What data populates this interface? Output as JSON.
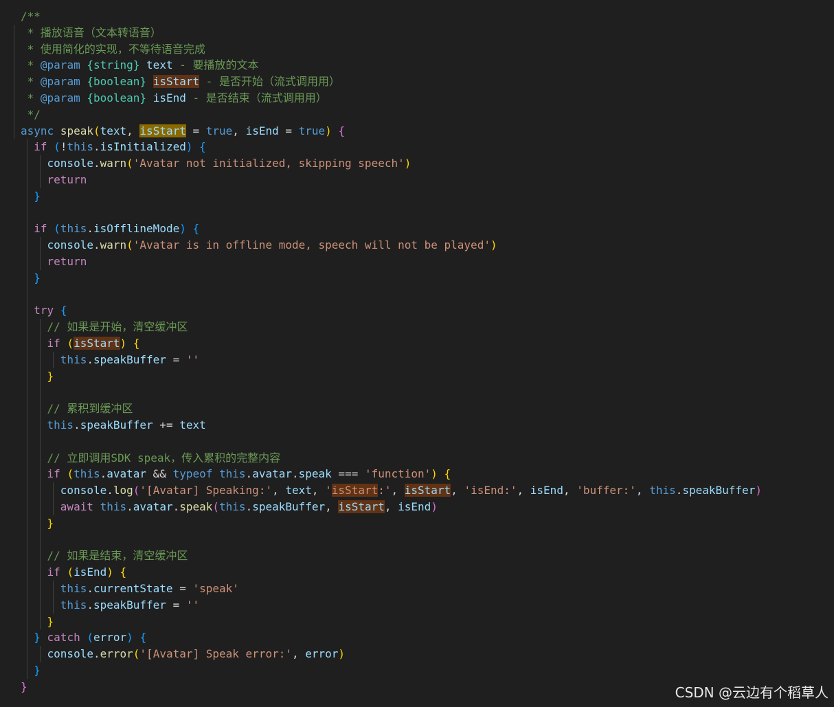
{
  "colors": {
    "background": "#1f1f1f",
    "comment": "#6a9955",
    "keyword_control": "#c586c0",
    "keyword": "#569cd6",
    "function": "#dcdcaa",
    "variable": "#9cdcfe",
    "string": "#ce9178",
    "plain": "#d4d4d4",
    "bracket_gold": "#ffd700",
    "bracket_purple": "#da70d6",
    "bracket_blue": "#179fff",
    "jsdoc_type": "#4ec9b0"
  },
  "code_lines": [
    [
      {
        "t": "/**",
        "c": "comment"
      }
    ],
    [
      {
        "t": " * 播放语音（文本转语音）",
        "c": "comment"
      }
    ],
    [
      {
        "t": " * 使用简化的实现，不等待语音完成",
        "c": "comment"
      }
    ],
    [
      {
        "t": " * ",
        "c": "comment"
      },
      {
        "t": "@param",
        "c": "keyword"
      },
      {
        "t": " ",
        "c": "comment"
      },
      {
        "t": "{string}",
        "c": "jsdoc_type"
      },
      {
        "t": " ",
        "c": "comment"
      },
      {
        "t": "text",
        "c": "variable"
      },
      {
        "t": " - 要播放的文本",
        "c": "comment"
      }
    ],
    [
      {
        "t": " * ",
        "c": "comment"
      },
      {
        "t": "@param",
        "c": "keyword"
      },
      {
        "t": " ",
        "c": "comment"
      },
      {
        "t": "{boolean}",
        "c": "jsdoc_type"
      },
      {
        "t": " ",
        "c": "comment"
      },
      {
        "t": "isStart",
        "c": "variable",
        "hl": "hl"
      },
      {
        "t": " - 是否开始（流式调用用）",
        "c": "comment"
      }
    ],
    [
      {
        "t": " * ",
        "c": "comment"
      },
      {
        "t": "@param",
        "c": "keyword"
      },
      {
        "t": " ",
        "c": "comment"
      },
      {
        "t": "{boolean}",
        "c": "jsdoc_type"
      },
      {
        "t": " ",
        "c": "comment"
      },
      {
        "t": "isEnd",
        "c": "variable"
      },
      {
        "t": " - 是否结束（流式调用用）",
        "c": "comment"
      }
    ],
    [
      {
        "t": " */",
        "c": "comment"
      }
    ],
    [
      {
        "t": "async",
        "c": "keyword"
      },
      {
        "t": " ",
        "c": "plain"
      },
      {
        "t": "speak",
        "c": "function"
      },
      {
        "t": "(",
        "c": "bracket_gold"
      },
      {
        "t": "text",
        "c": "variable"
      },
      {
        "t": ", ",
        "c": "plain"
      },
      {
        "t": "isStart",
        "c": "variable",
        "hl": "hl-strong"
      },
      {
        "t": " = ",
        "c": "plain"
      },
      {
        "t": "true",
        "c": "keyword"
      },
      {
        "t": ", ",
        "c": "plain"
      },
      {
        "t": "isEnd",
        "c": "variable"
      },
      {
        "t": " = ",
        "c": "plain"
      },
      {
        "t": "true",
        "c": "keyword"
      },
      {
        "t": ")",
        "c": "bracket_gold"
      },
      {
        "t": " ",
        "c": "plain"
      },
      {
        "t": "{",
        "c": "bracket_purple"
      }
    ],
    [
      {
        "t": "  ",
        "c": "plain"
      },
      {
        "t": "if",
        "c": "keyword_control"
      },
      {
        "t": " ",
        "c": "plain"
      },
      {
        "t": "(",
        "c": "bracket_blue"
      },
      {
        "t": "!",
        "c": "plain"
      },
      {
        "t": "this",
        "c": "keyword"
      },
      {
        "t": ".",
        "c": "plain"
      },
      {
        "t": "isInitialized",
        "c": "variable"
      },
      {
        "t": ")",
        "c": "bracket_blue"
      },
      {
        "t": " ",
        "c": "plain"
      },
      {
        "t": "{",
        "c": "bracket_blue"
      }
    ],
    [
      {
        "t": "    ",
        "c": "plain"
      },
      {
        "t": "console",
        "c": "variable"
      },
      {
        "t": ".",
        "c": "plain"
      },
      {
        "t": "warn",
        "c": "function"
      },
      {
        "t": "(",
        "c": "bracket_gold"
      },
      {
        "t": "'Avatar not initialized, skipping speech'",
        "c": "string"
      },
      {
        "t": ")",
        "c": "bracket_gold"
      }
    ],
    [
      {
        "t": "    ",
        "c": "plain"
      },
      {
        "t": "return",
        "c": "keyword_control"
      }
    ],
    [
      {
        "t": "  ",
        "c": "plain"
      },
      {
        "t": "}",
        "c": "bracket_blue"
      }
    ],
    [],
    [
      {
        "t": "  ",
        "c": "plain"
      },
      {
        "t": "if",
        "c": "keyword_control"
      },
      {
        "t": " ",
        "c": "plain"
      },
      {
        "t": "(",
        "c": "bracket_blue"
      },
      {
        "t": "this",
        "c": "keyword"
      },
      {
        "t": ".",
        "c": "plain"
      },
      {
        "t": "isOfflineMode",
        "c": "variable"
      },
      {
        "t": ")",
        "c": "bracket_blue"
      },
      {
        "t": " ",
        "c": "plain"
      },
      {
        "t": "{",
        "c": "bracket_blue"
      }
    ],
    [
      {
        "t": "    ",
        "c": "plain"
      },
      {
        "t": "console",
        "c": "variable"
      },
      {
        "t": ".",
        "c": "plain"
      },
      {
        "t": "warn",
        "c": "function"
      },
      {
        "t": "(",
        "c": "bracket_gold"
      },
      {
        "t": "'Avatar is in offline mode, speech will not be played'",
        "c": "string"
      },
      {
        "t": ")",
        "c": "bracket_gold"
      }
    ],
    [
      {
        "t": "    ",
        "c": "plain"
      },
      {
        "t": "return",
        "c": "keyword_control"
      }
    ],
    [
      {
        "t": "  ",
        "c": "plain"
      },
      {
        "t": "}",
        "c": "bracket_blue"
      }
    ],
    [],
    [
      {
        "t": "  ",
        "c": "plain"
      },
      {
        "t": "try",
        "c": "keyword_control"
      },
      {
        "t": " ",
        "c": "plain"
      },
      {
        "t": "{",
        "c": "bracket_blue"
      }
    ],
    [
      {
        "t": "    ",
        "c": "plain"
      },
      {
        "t": "// 如果是开始，清空缓冲区",
        "c": "comment"
      }
    ],
    [
      {
        "t": "    ",
        "c": "plain"
      },
      {
        "t": "if",
        "c": "keyword_control"
      },
      {
        "t": " ",
        "c": "plain"
      },
      {
        "t": "(",
        "c": "bracket_gold"
      },
      {
        "t": "isStart",
        "c": "variable",
        "hl": "hl"
      },
      {
        "t": ")",
        "c": "bracket_gold"
      },
      {
        "t": " ",
        "c": "plain"
      },
      {
        "t": "{",
        "c": "bracket_gold"
      }
    ],
    [
      {
        "t": "      ",
        "c": "plain"
      },
      {
        "t": "this",
        "c": "keyword"
      },
      {
        "t": ".",
        "c": "plain"
      },
      {
        "t": "speakBuffer",
        "c": "variable"
      },
      {
        "t": " = ",
        "c": "plain"
      },
      {
        "t": "''",
        "c": "string"
      }
    ],
    [
      {
        "t": "    ",
        "c": "plain"
      },
      {
        "t": "}",
        "c": "bracket_gold"
      }
    ],
    [],
    [
      {
        "t": "    ",
        "c": "plain"
      },
      {
        "t": "// 累积到缓冲区",
        "c": "comment"
      }
    ],
    [
      {
        "t": "    ",
        "c": "plain"
      },
      {
        "t": "this",
        "c": "keyword"
      },
      {
        "t": ".",
        "c": "plain"
      },
      {
        "t": "speakBuffer",
        "c": "variable"
      },
      {
        "t": " += ",
        "c": "plain"
      },
      {
        "t": "text",
        "c": "variable"
      }
    ],
    [],
    [
      {
        "t": "    ",
        "c": "plain"
      },
      {
        "t": "// 立即调用SDK speak，传入累积的完整内容",
        "c": "comment"
      }
    ],
    [
      {
        "t": "    ",
        "c": "plain"
      },
      {
        "t": "if",
        "c": "keyword_control"
      },
      {
        "t": " ",
        "c": "plain"
      },
      {
        "t": "(",
        "c": "bracket_gold"
      },
      {
        "t": "this",
        "c": "keyword"
      },
      {
        "t": ".",
        "c": "plain"
      },
      {
        "t": "avatar",
        "c": "variable"
      },
      {
        "t": " && ",
        "c": "plain"
      },
      {
        "t": "typeof",
        "c": "keyword"
      },
      {
        "t": " ",
        "c": "plain"
      },
      {
        "t": "this",
        "c": "keyword"
      },
      {
        "t": ".",
        "c": "plain"
      },
      {
        "t": "avatar",
        "c": "variable"
      },
      {
        "t": ".",
        "c": "plain"
      },
      {
        "t": "speak",
        "c": "variable"
      },
      {
        "t": " === ",
        "c": "plain"
      },
      {
        "t": "'function'",
        "c": "string"
      },
      {
        "t": ")",
        "c": "bracket_gold"
      },
      {
        "t": " ",
        "c": "plain"
      },
      {
        "t": "{",
        "c": "bracket_gold"
      }
    ],
    [
      {
        "t": "      ",
        "c": "plain"
      },
      {
        "t": "console",
        "c": "variable"
      },
      {
        "t": ".",
        "c": "plain"
      },
      {
        "t": "log",
        "c": "function"
      },
      {
        "t": "(",
        "c": "bracket_purple"
      },
      {
        "t": "'[Avatar] Speaking:'",
        "c": "string"
      },
      {
        "t": ", ",
        "c": "plain"
      },
      {
        "t": "text",
        "c": "variable"
      },
      {
        "t": ", ",
        "c": "plain"
      },
      {
        "t": "'",
        "c": "string"
      },
      {
        "t": "isStart",
        "c": "string",
        "hl": "hl"
      },
      {
        "t": ":'",
        "c": "string"
      },
      {
        "t": ", ",
        "c": "plain"
      },
      {
        "t": "isStart",
        "c": "variable",
        "hl": "hl"
      },
      {
        "t": ", ",
        "c": "plain"
      },
      {
        "t": "'isEnd:'",
        "c": "string"
      },
      {
        "t": ", ",
        "c": "plain"
      },
      {
        "t": "isEnd",
        "c": "variable"
      },
      {
        "t": ", ",
        "c": "plain"
      },
      {
        "t": "'buffer:'",
        "c": "string"
      },
      {
        "t": ", ",
        "c": "plain"
      },
      {
        "t": "this",
        "c": "keyword"
      },
      {
        "t": ".",
        "c": "plain"
      },
      {
        "t": "speakBuffer",
        "c": "variable"
      },
      {
        "t": ")",
        "c": "bracket_purple"
      }
    ],
    [
      {
        "t": "      ",
        "c": "plain"
      },
      {
        "t": "await",
        "c": "keyword_control"
      },
      {
        "t": " ",
        "c": "plain"
      },
      {
        "t": "this",
        "c": "keyword"
      },
      {
        "t": ".",
        "c": "plain"
      },
      {
        "t": "avatar",
        "c": "variable"
      },
      {
        "t": ".",
        "c": "plain"
      },
      {
        "t": "speak",
        "c": "function"
      },
      {
        "t": "(",
        "c": "bracket_purple"
      },
      {
        "t": "this",
        "c": "keyword"
      },
      {
        "t": ".",
        "c": "plain"
      },
      {
        "t": "speakBuffer",
        "c": "variable"
      },
      {
        "t": ", ",
        "c": "plain"
      },
      {
        "t": "isStart",
        "c": "variable",
        "hl": "hl"
      },
      {
        "t": ", ",
        "c": "plain"
      },
      {
        "t": "isEnd",
        "c": "variable"
      },
      {
        "t": ")",
        "c": "bracket_purple"
      }
    ],
    [
      {
        "t": "    ",
        "c": "plain"
      },
      {
        "t": "}",
        "c": "bracket_gold"
      }
    ],
    [],
    [
      {
        "t": "    ",
        "c": "plain"
      },
      {
        "t": "// 如果是结束，清空缓冲区",
        "c": "comment"
      }
    ],
    [
      {
        "t": "    ",
        "c": "plain"
      },
      {
        "t": "if",
        "c": "keyword_control"
      },
      {
        "t": " ",
        "c": "plain"
      },
      {
        "t": "(",
        "c": "bracket_gold"
      },
      {
        "t": "isEnd",
        "c": "variable"
      },
      {
        "t": ")",
        "c": "bracket_gold"
      },
      {
        "t": " ",
        "c": "plain"
      },
      {
        "t": "{",
        "c": "bracket_gold"
      }
    ],
    [
      {
        "t": "      ",
        "c": "plain"
      },
      {
        "t": "this",
        "c": "keyword"
      },
      {
        "t": ".",
        "c": "plain"
      },
      {
        "t": "currentState",
        "c": "variable"
      },
      {
        "t": " = ",
        "c": "plain"
      },
      {
        "t": "'speak'",
        "c": "string"
      }
    ],
    [
      {
        "t": "      ",
        "c": "plain"
      },
      {
        "t": "this",
        "c": "keyword"
      },
      {
        "t": ".",
        "c": "plain"
      },
      {
        "t": "speakBuffer",
        "c": "variable"
      },
      {
        "t": " = ",
        "c": "plain"
      },
      {
        "t": "''",
        "c": "string"
      }
    ],
    [
      {
        "t": "    ",
        "c": "plain"
      },
      {
        "t": "}",
        "c": "bracket_gold"
      }
    ],
    [
      {
        "t": "  ",
        "c": "plain"
      },
      {
        "t": "}",
        "c": "bracket_blue"
      },
      {
        "t": " ",
        "c": "plain"
      },
      {
        "t": "catch",
        "c": "keyword_control"
      },
      {
        "t": " ",
        "c": "plain"
      },
      {
        "t": "(",
        "c": "bracket_blue"
      },
      {
        "t": "error",
        "c": "variable"
      },
      {
        "t": ")",
        "c": "bracket_blue"
      },
      {
        "t": " ",
        "c": "plain"
      },
      {
        "t": "{",
        "c": "bracket_blue"
      }
    ],
    [
      {
        "t": "    ",
        "c": "plain"
      },
      {
        "t": "console",
        "c": "variable"
      },
      {
        "t": ".",
        "c": "plain"
      },
      {
        "t": "error",
        "c": "function"
      },
      {
        "t": "(",
        "c": "bracket_gold"
      },
      {
        "t": "'[Avatar] Speak error:'",
        "c": "string"
      },
      {
        "t": ", ",
        "c": "plain"
      },
      {
        "t": "error",
        "c": "variable"
      },
      {
        "t": ")",
        "c": "bracket_gold"
      }
    ],
    [
      {
        "t": "  ",
        "c": "plain"
      },
      {
        "t": "}",
        "c": "bracket_blue"
      }
    ],
    [
      {
        "t": "}",
        "c": "bracket_purple"
      }
    ]
  ],
  "watermark": "CSDN @云边有个稻草人"
}
